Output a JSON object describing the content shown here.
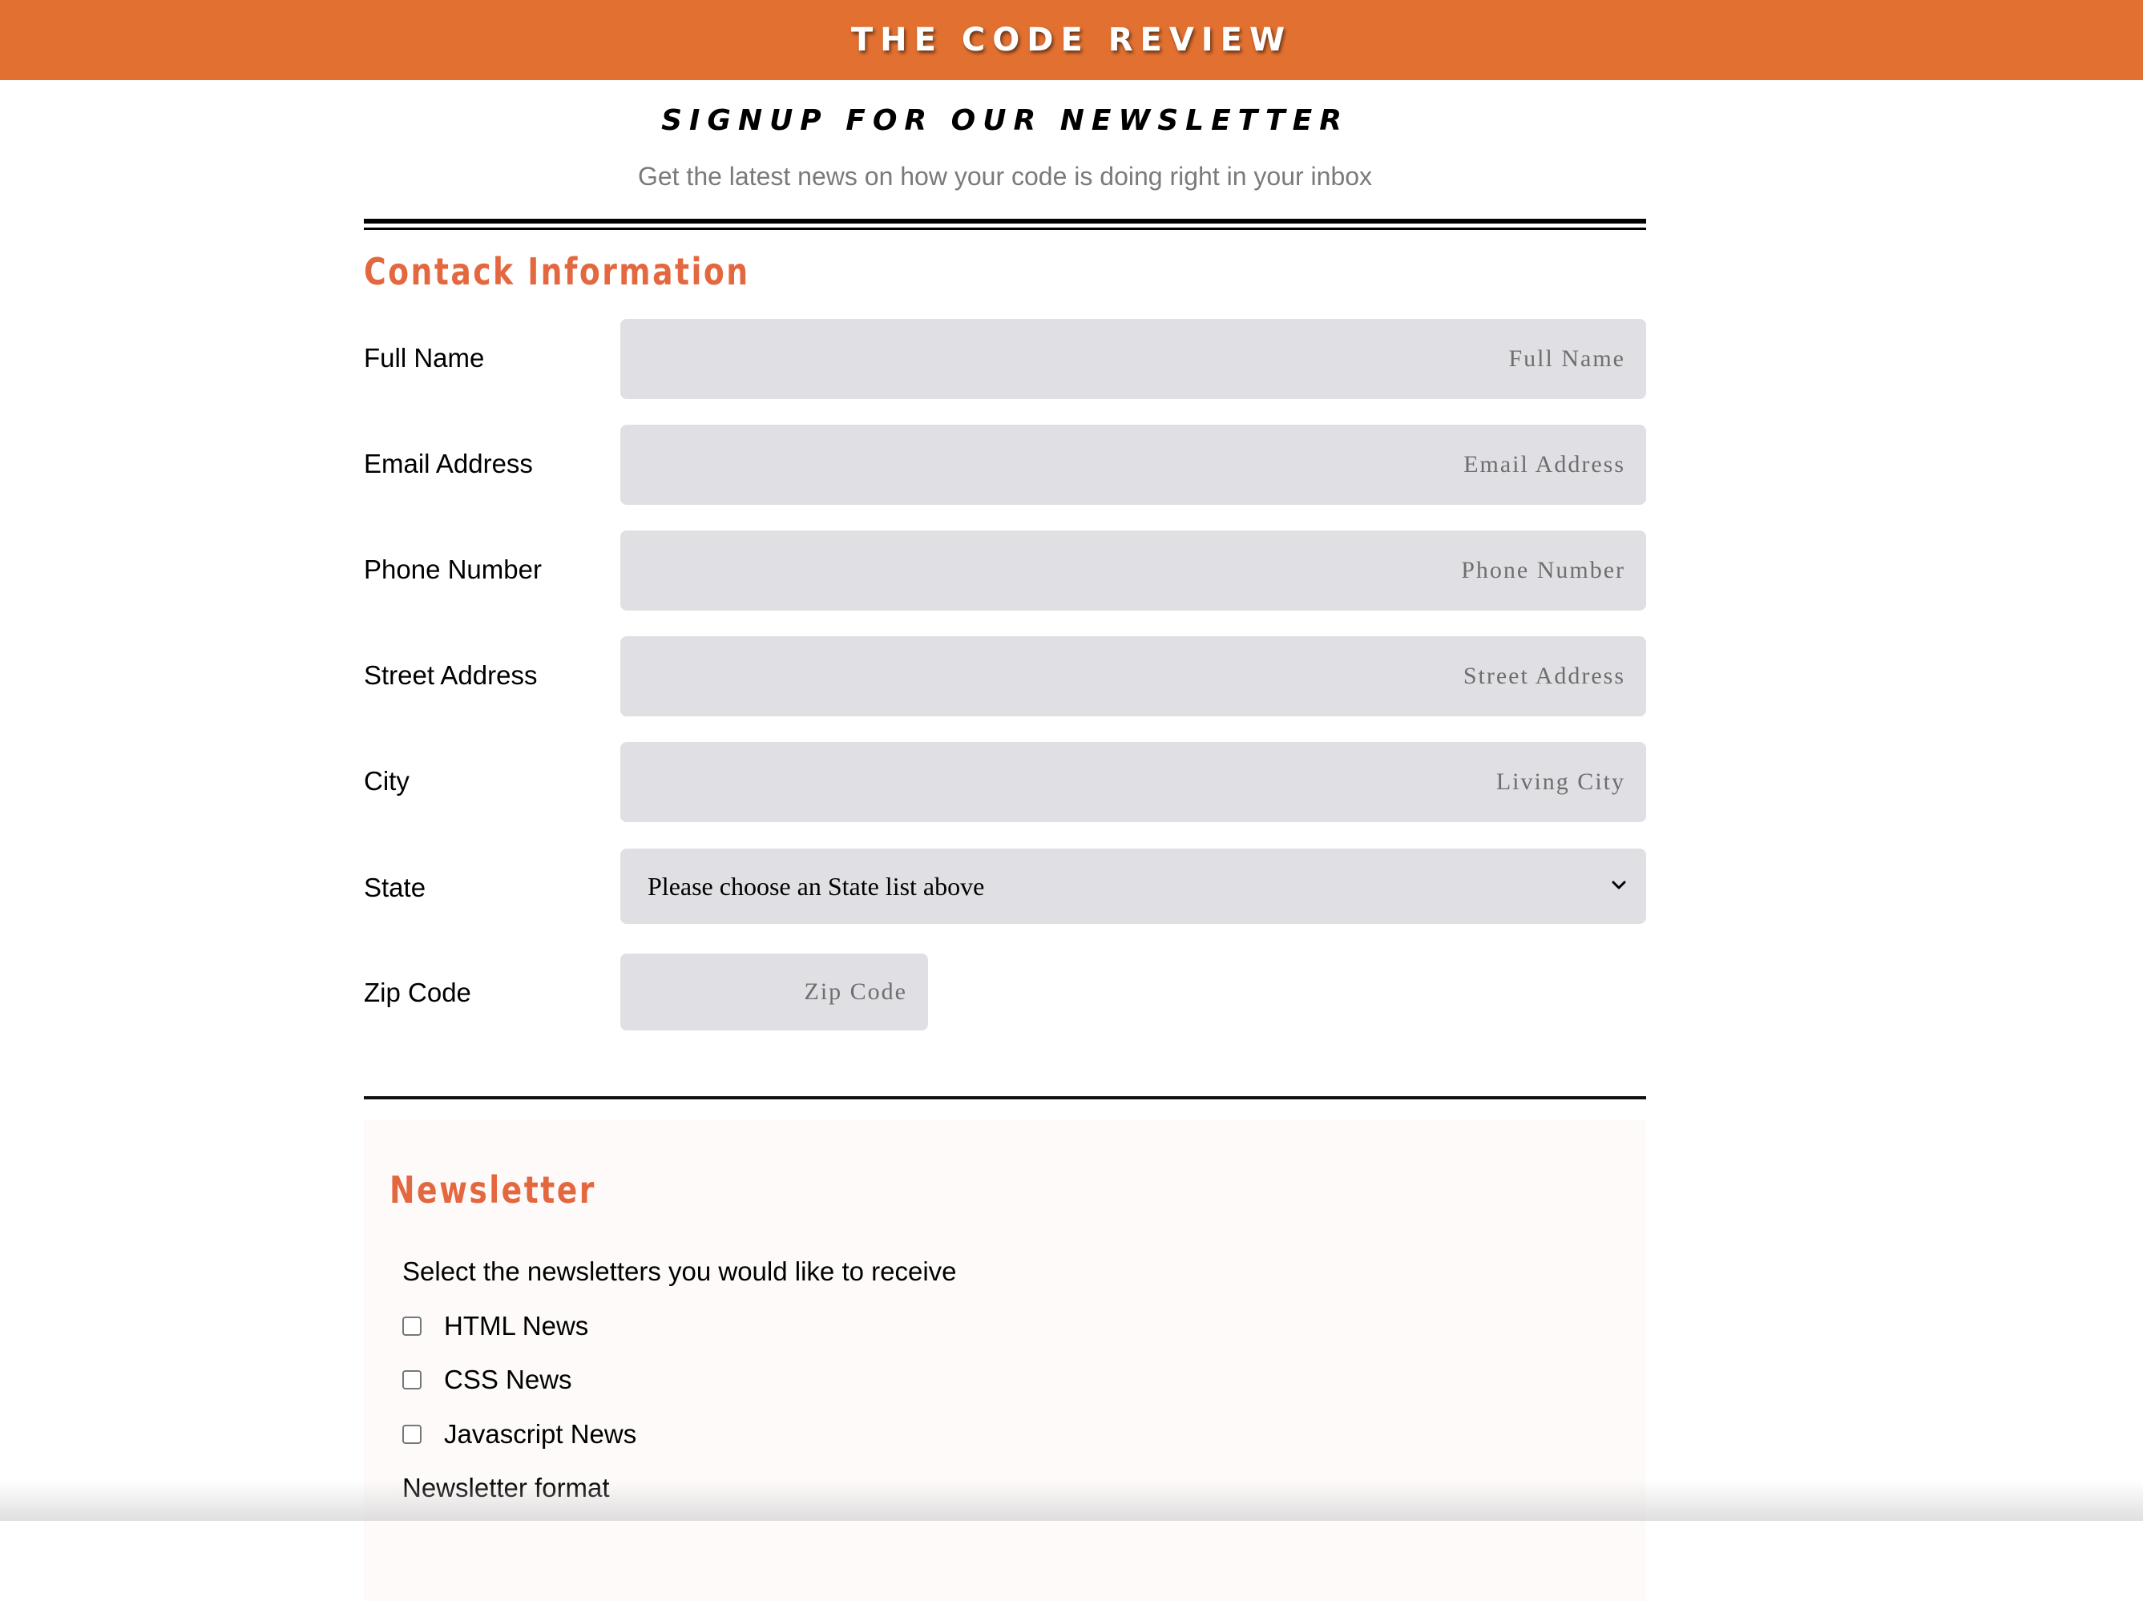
{
  "header": {
    "brand": "THE CODE REVIEW",
    "accent_color": "#e27131"
  },
  "intro": {
    "title": "SIGNUP FOR OUR NEWSLETTER",
    "subtitle": "Get the latest news on how your code is doing right in your inbox"
  },
  "contact": {
    "title": "Contack Information",
    "title_color": "#e3683f",
    "fields": [
      {
        "label": "Full Name",
        "placeholder": "Full Name",
        "value": ""
      },
      {
        "label": "Email Address",
        "placeholder": "Email Address",
        "value": ""
      },
      {
        "label": "Phone Number",
        "placeholder": "Phone Number",
        "value": ""
      },
      {
        "label": "Street Address",
        "placeholder": "Street Address",
        "value": ""
      },
      {
        "label": "City",
        "placeholder": "Living City",
        "value": ""
      }
    ],
    "state": {
      "label": "State",
      "selected": "Please choose an State list above",
      "icon": "chevron-down-icon"
    },
    "zip": {
      "label": "Zip Code",
      "placeholder": "Zip Code",
      "value": ""
    }
  },
  "newsletter": {
    "title": "Newsletter",
    "prompt": "Select the newsletters you would like to receive",
    "options": [
      {
        "label": "HTML News",
        "checked": false
      },
      {
        "label": "CSS News",
        "checked": false
      },
      {
        "label": "Javascript News",
        "checked": false
      }
    ],
    "format_label": "Newsletter format"
  }
}
